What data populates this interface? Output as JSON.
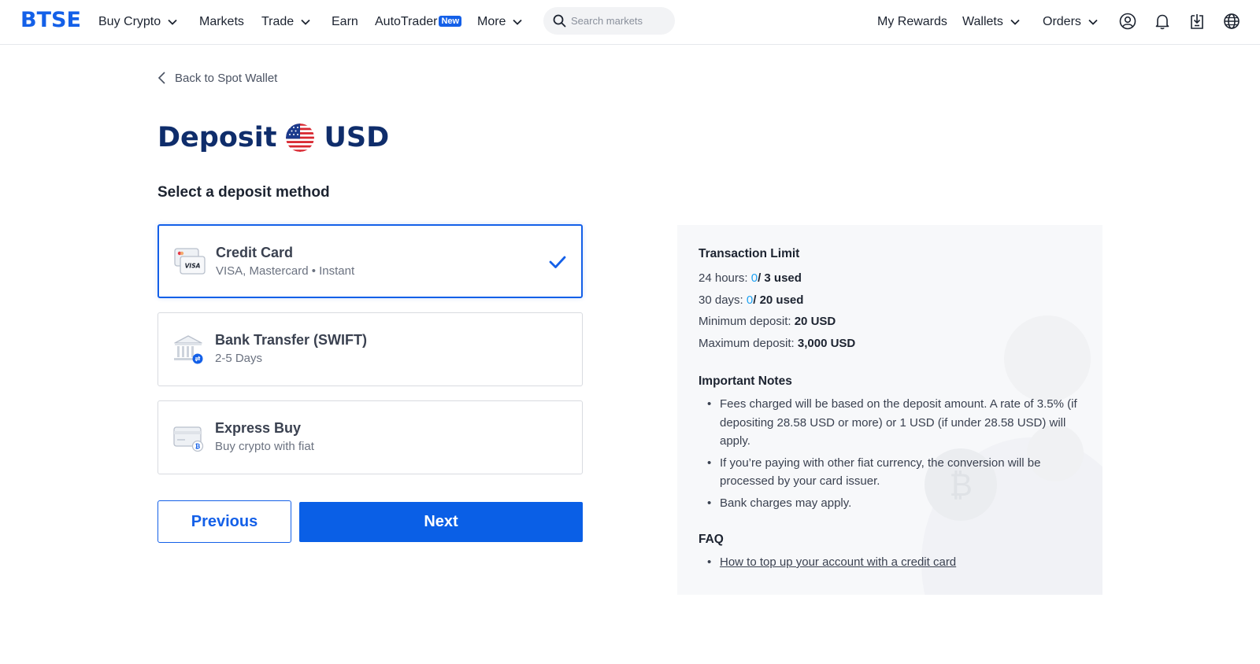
{
  "nav": {
    "logo": "BTSE",
    "items": [
      {
        "label": "Buy Crypto",
        "dropdown": true
      },
      {
        "label": "Markets",
        "dropdown": false
      },
      {
        "label": "Trade",
        "dropdown": true
      },
      {
        "label": "Earn",
        "dropdown": false
      },
      {
        "label": "AutoTrader",
        "badge": "New",
        "dropdown": false
      },
      {
        "label": "More",
        "dropdown": true
      }
    ],
    "search_placeholder": "Search markets",
    "right_items": [
      {
        "label": "My Rewards",
        "dropdown": false
      },
      {
        "label": "Wallets",
        "dropdown": true
      },
      {
        "label": "Orders",
        "dropdown": true
      }
    ],
    "icons": [
      "account-icon",
      "bell-icon",
      "download-icon",
      "globe-icon"
    ]
  },
  "back_link": "Back to Spot Wallet",
  "title": {
    "prefix": "Deposit",
    "currency": "USD"
  },
  "section_title": "Select a deposit method",
  "methods": [
    {
      "title": "Credit Card",
      "subtitle": "VISA, Mastercard • Instant",
      "selected": true,
      "icon": "credit-card-icon"
    },
    {
      "title": "Bank Transfer (SWIFT)",
      "subtitle": "2-5 Days",
      "selected": false,
      "icon": "bank-icon"
    },
    {
      "title": "Express Buy",
      "subtitle": "Buy crypto with fiat",
      "selected": false,
      "icon": "express-buy-icon"
    }
  ],
  "buttons": {
    "previous": "Previous",
    "next": "Next"
  },
  "info": {
    "limit_title": "Transaction Limit",
    "h24": {
      "label": "24 hours:",
      "used": "0",
      "total": "/ 3 used"
    },
    "d30": {
      "label": "30 days:",
      "used": "0",
      "total": "/ 20 used"
    },
    "min": {
      "label": "Minimum deposit:",
      "value": "20 USD"
    },
    "max": {
      "label": "Maximum deposit:",
      "value": "3,000 USD"
    },
    "notes_title": "Important Notes",
    "notes": [
      "Fees charged will be based on the deposit amount. A rate of 3.5% (if depositing 28.58 USD or more) or 1 USD (if under 28.58 USD) will apply.",
      "If you’re paying with other fiat currency, the conversion will be processed by your card issuer.",
      "Bank charges may apply."
    ],
    "faq_title": "FAQ",
    "faq_links": [
      "How to top up your account with a credit card"
    ]
  },
  "colors": {
    "brand": "#1460e8",
    "title": "#0f2d6b",
    "highlight": "#1da1f2",
    "panel_bg": "#f7f8fa"
  }
}
